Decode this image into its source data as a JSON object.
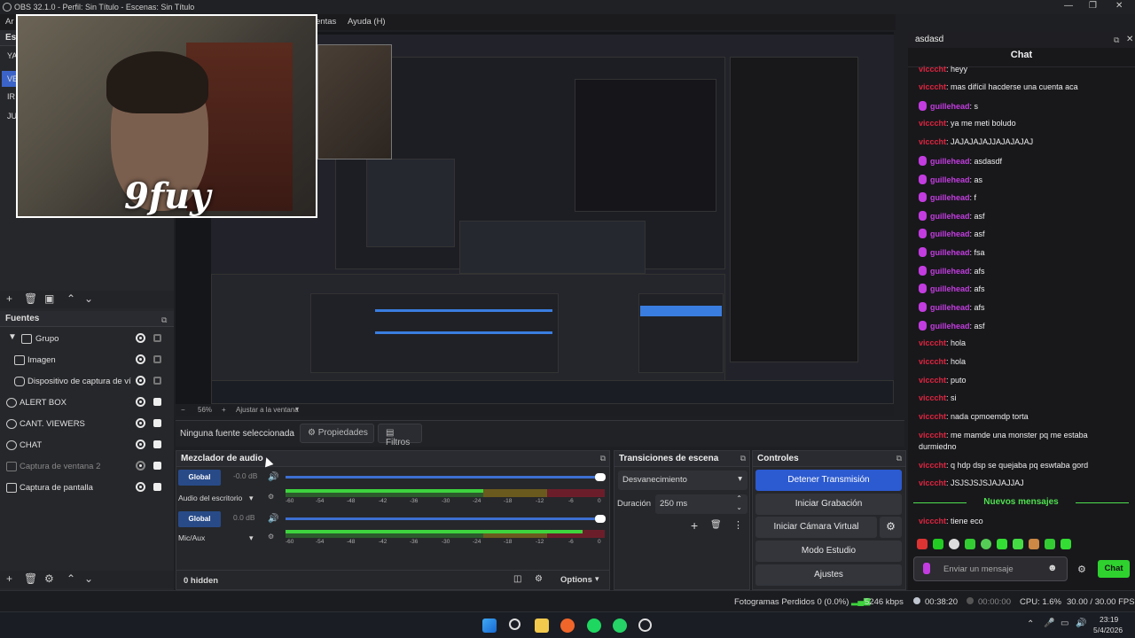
{
  "window": {
    "title": "OBS 32.1.0 - Perfil: Sin Título - Escenas: Sin Título",
    "controls": [
      "—",
      "❐",
      "✕"
    ]
  },
  "menu": {
    "items": [
      "Ar",
      "entas",
      "Ayuda (H)"
    ]
  },
  "scenes_panel": {
    "title": "Esc",
    "items": [
      "YA",
      "VE",
      "IR",
      "JU"
    ]
  },
  "sources_panel": {
    "title": "Fuentes",
    "items": [
      {
        "label": "Grupo",
        "icon": "folder-icon",
        "visible": true,
        "locked": false,
        "dim": false
      },
      {
        "label": "Imagen",
        "icon": "image-icon",
        "visible": true,
        "locked": false,
        "dim": false
      },
      {
        "label": "Dispositivo de captura de vídeo",
        "icon": "camera-icon",
        "visible": true,
        "locked": false,
        "dim": false
      },
      {
        "label": "ALERT BOX",
        "icon": "globe-icon",
        "visible": true,
        "locked": true,
        "dim": false
      },
      {
        "label": "CANT. VIEWERS",
        "icon": "globe-icon",
        "visible": true,
        "locked": true,
        "dim": false
      },
      {
        "label": "CHAT",
        "icon": "globe-icon",
        "visible": true,
        "locked": true,
        "dim": false
      },
      {
        "label": "Captura de ventana 2",
        "icon": "window-icon",
        "visible": false,
        "locked": true,
        "dim": true
      },
      {
        "label": "Captura de pantalla",
        "icon": "monitor-icon",
        "visible": true,
        "locked": true,
        "dim": false
      }
    ]
  },
  "webcam": {
    "logo_text": "9fuy"
  },
  "zoom": {
    "level": "56%",
    "fit_label": "Ajustar a la ventana"
  },
  "source_bar": {
    "no_source": "Ninguna fuente seleccionada",
    "properties": "Propiedades",
    "filters": "Filtros"
  },
  "mixer": {
    "title": "Mezclador de audio",
    "channels": [
      {
        "name": "Audio del escritorio",
        "db": "-0.0 dB",
        "group": "Global",
        "level": 0.62
      },
      {
        "name": "Mic/Aux",
        "db": "0.0 dB",
        "group": "Global",
        "level": 0.93
      }
    ],
    "scale": [
      "-60",
      "-54",
      "-48",
      "-42",
      "-36",
      "-30",
      "-24",
      "-18",
      "-12",
      "-6",
      "0"
    ],
    "hidden": "0 hidden",
    "options": "Options"
  },
  "transitions": {
    "title": "Transiciones de escena",
    "selected": "Desvanecimiento",
    "duration_label": "Duración",
    "duration_value": "250 ms"
  },
  "controls": {
    "title": "Controles",
    "buttons": [
      "Detener Transmisión",
      "Iniciar Grabación",
      "Iniciar Cámara Virtual",
      "Modo Estudio",
      "Ajustes"
    ]
  },
  "status": {
    "dropped": "Fotogramas Perdidos 0 (0.0%)",
    "bitrate": "5246 kbps",
    "live_time": "00:38:20",
    "rec_time": "00:00:00",
    "cpu": "CPU: 1.6%",
    "fps": "30.00 / 30.00 FPS"
  },
  "chat": {
    "window_title": "asdasd",
    "title": "Chat",
    "messages": [
      {
        "user": "vicccht",
        "text": "heyy",
        "badge": false
      },
      {
        "user": "vicccht",
        "text": "mas difícil hacderse una cuenta aca",
        "badge": false
      },
      {
        "user": "guillehead",
        "text": "s",
        "badge": true
      },
      {
        "user": "vicccht",
        "text": "ya me meti boludo",
        "badge": false
      },
      {
        "user": "vicccht",
        "text": "JAJAJAJAJJAJAJAJAJ",
        "badge": false
      },
      {
        "user": "guillehead",
        "text": "asdasdf",
        "badge": true
      },
      {
        "user": "guillehead",
        "text": "as",
        "badge": true
      },
      {
        "user": "guillehead",
        "text": "f",
        "badge": true
      },
      {
        "user": "guillehead",
        "text": "asf",
        "badge": true
      },
      {
        "user": "guillehead",
        "text": "asf",
        "badge": true
      },
      {
        "user": "guillehead",
        "text": "fsa",
        "badge": true
      },
      {
        "user": "guillehead",
        "text": "afs",
        "badge": true
      },
      {
        "user": "guillehead",
        "text": "afs",
        "badge": true
      },
      {
        "user": "guillehead",
        "text": "afs",
        "badge": true
      },
      {
        "user": "guillehead",
        "text": "asf",
        "badge": true
      },
      {
        "user": "vicccht",
        "text": "hola",
        "badge": false
      },
      {
        "user": "vicccht",
        "text": "hola",
        "badge": false
      },
      {
        "user": "vicccht",
        "text": "puto",
        "badge": false
      },
      {
        "user": "vicccht",
        "text": "si",
        "badge": false
      },
      {
        "user": "vicccht",
        "text": "nada cpmoemdp torta",
        "badge": false
      },
      {
        "user": "vicccht",
        "text": "me mamde una monster pq me estaba",
        "badge": false
      },
      {
        "user": "",
        "text": "durmiedno",
        "badge": false
      },
      {
        "user": "vicccht",
        "text": "q hdp dsp se quejaba pq eswtaba gord",
        "badge": false
      },
      {
        "user": "vicccht",
        "text": "JSJSJSJSJAJAJJAJ",
        "badge": false
      }
    ],
    "new_messages": "Nuevos mensajes",
    "last_message": {
      "user": "vicccht",
      "text": "tiene eco"
    },
    "input_placeholder": "Enviar un mensaje",
    "send_label": "Chat",
    "user_color": "#e0243f",
    "badge_user_color": "#c33ce0"
  },
  "taskbar": {
    "time": "23:19",
    "date": "5/4/2026"
  }
}
